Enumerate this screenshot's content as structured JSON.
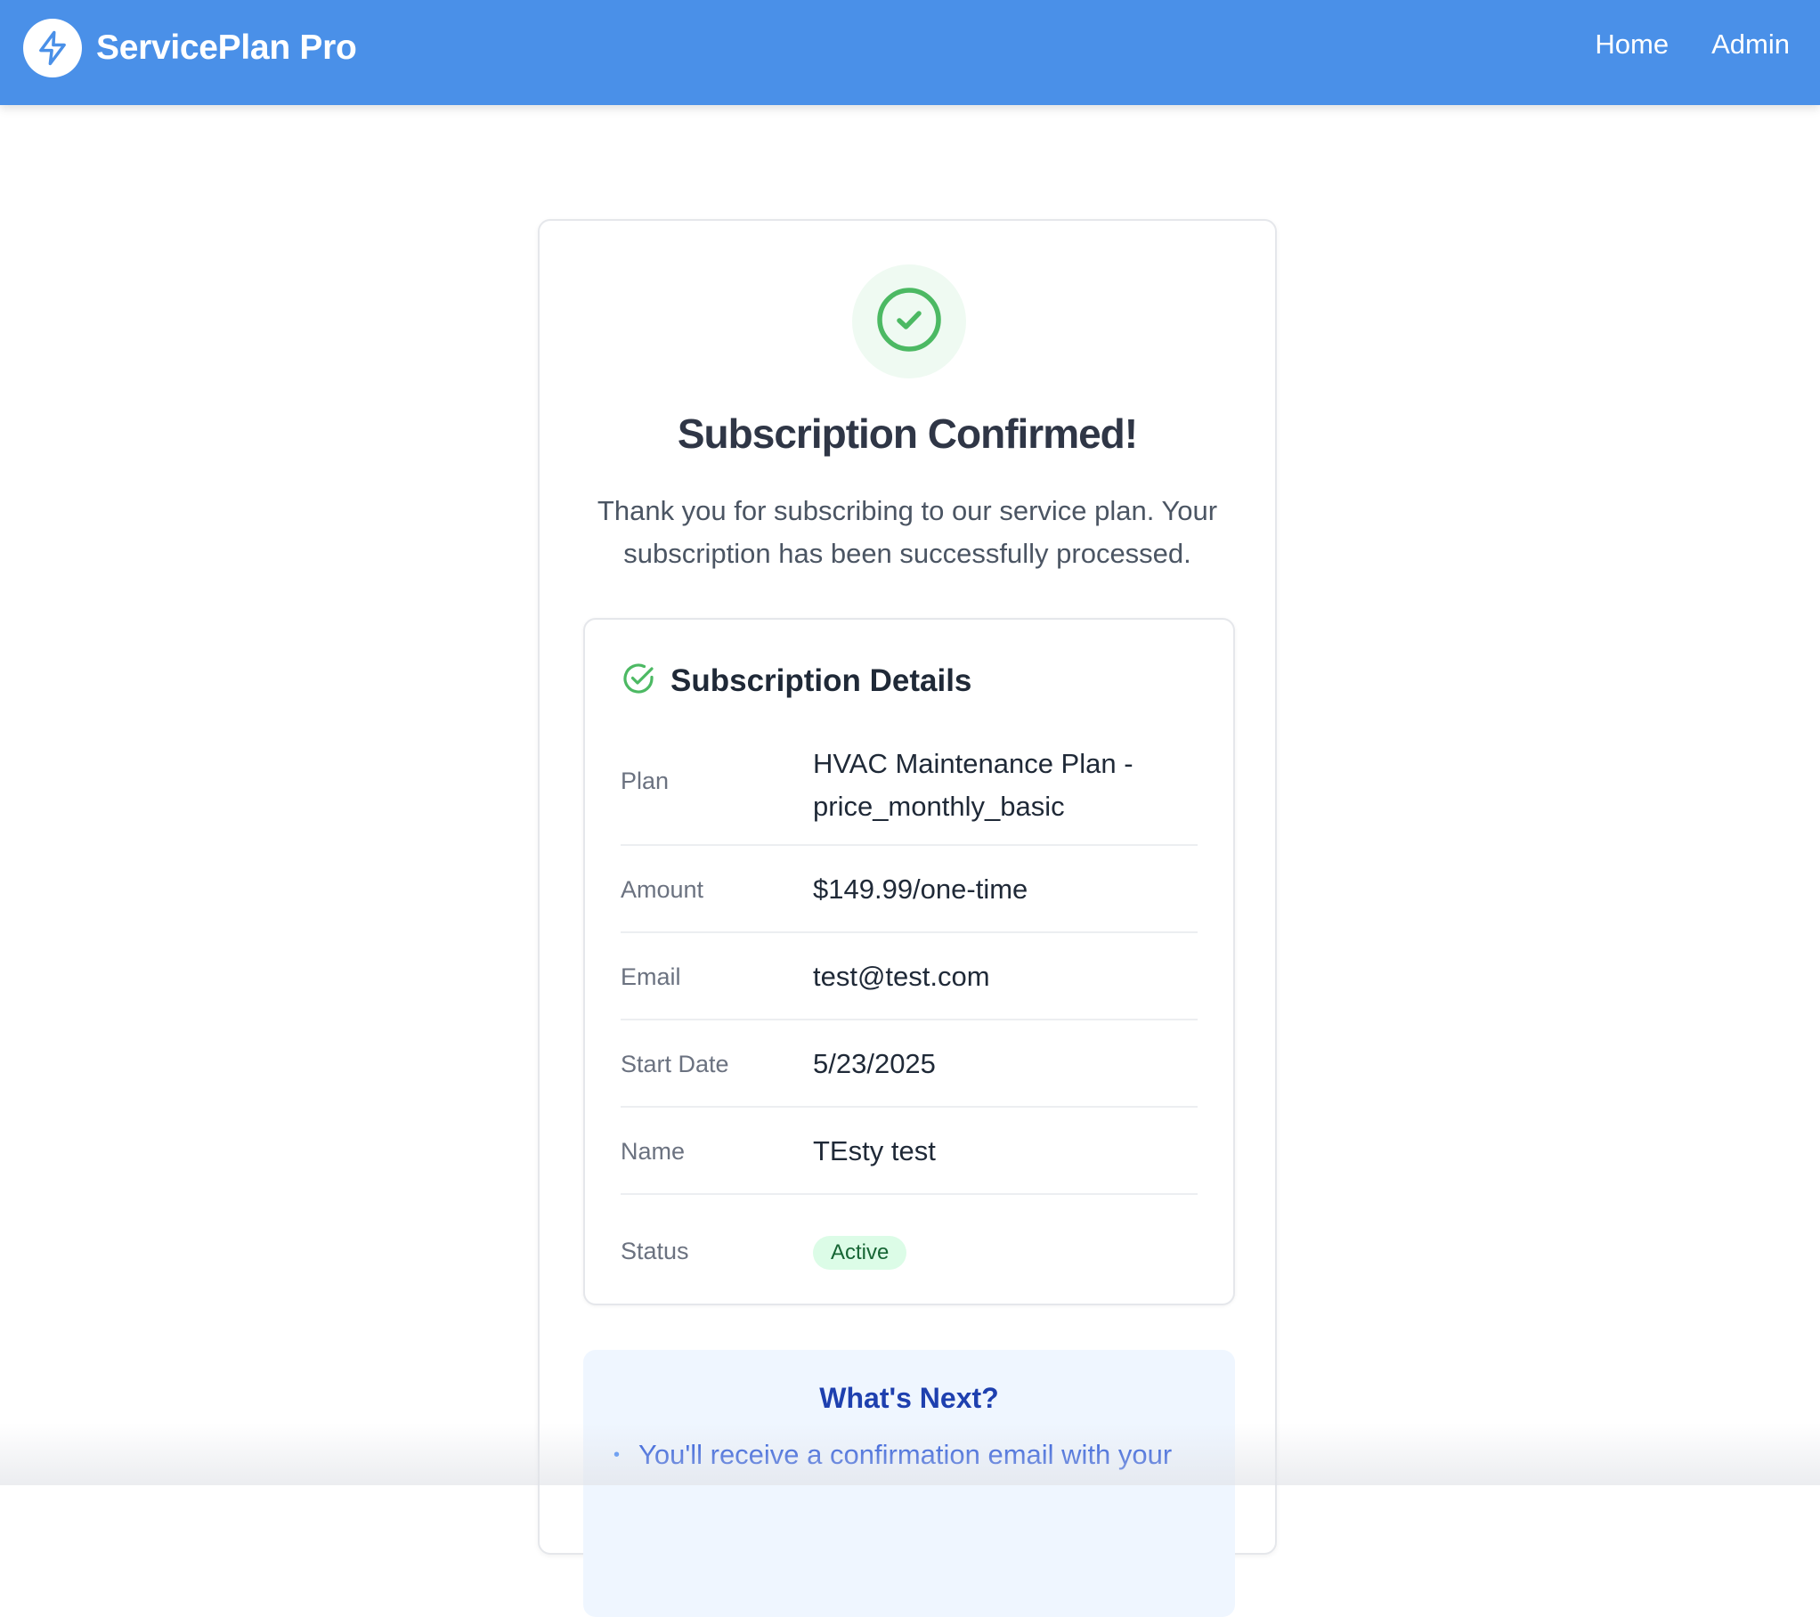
{
  "header": {
    "brand_name": "ServicePlan Pro",
    "logo_icon": "lightning-bolt-icon",
    "background_color": "#4a90e8",
    "nav": [
      {
        "label": "Home"
      },
      {
        "label": "Admin"
      }
    ]
  },
  "confirmation": {
    "icon": "check-circle-icon",
    "accent_color": "#4cb963",
    "title": "Subscription Confirmed!",
    "message": "Thank you for subscribing to our service plan. Your subscription has been successfully processed."
  },
  "details": {
    "icon": "check-circle-icon",
    "title": "Subscription Details",
    "rows": [
      {
        "label": "Plan",
        "value": "HVAC Maintenance Plan - price_monthly_basic"
      },
      {
        "label": "Amount",
        "value": "$149.99/one-time"
      },
      {
        "label": "Email",
        "value": "test@test.com"
      },
      {
        "label": "Start Date",
        "value": "5/23/2025"
      },
      {
        "label": "Name",
        "value": "TEsty test"
      },
      {
        "label": "Status",
        "value": "Active",
        "badge_color": "#dcfce7"
      }
    ]
  },
  "whats_next": {
    "title": "What's Next?",
    "items": [
      {
        "text": "You'll receive a confirmation email with your"
      }
    ]
  }
}
